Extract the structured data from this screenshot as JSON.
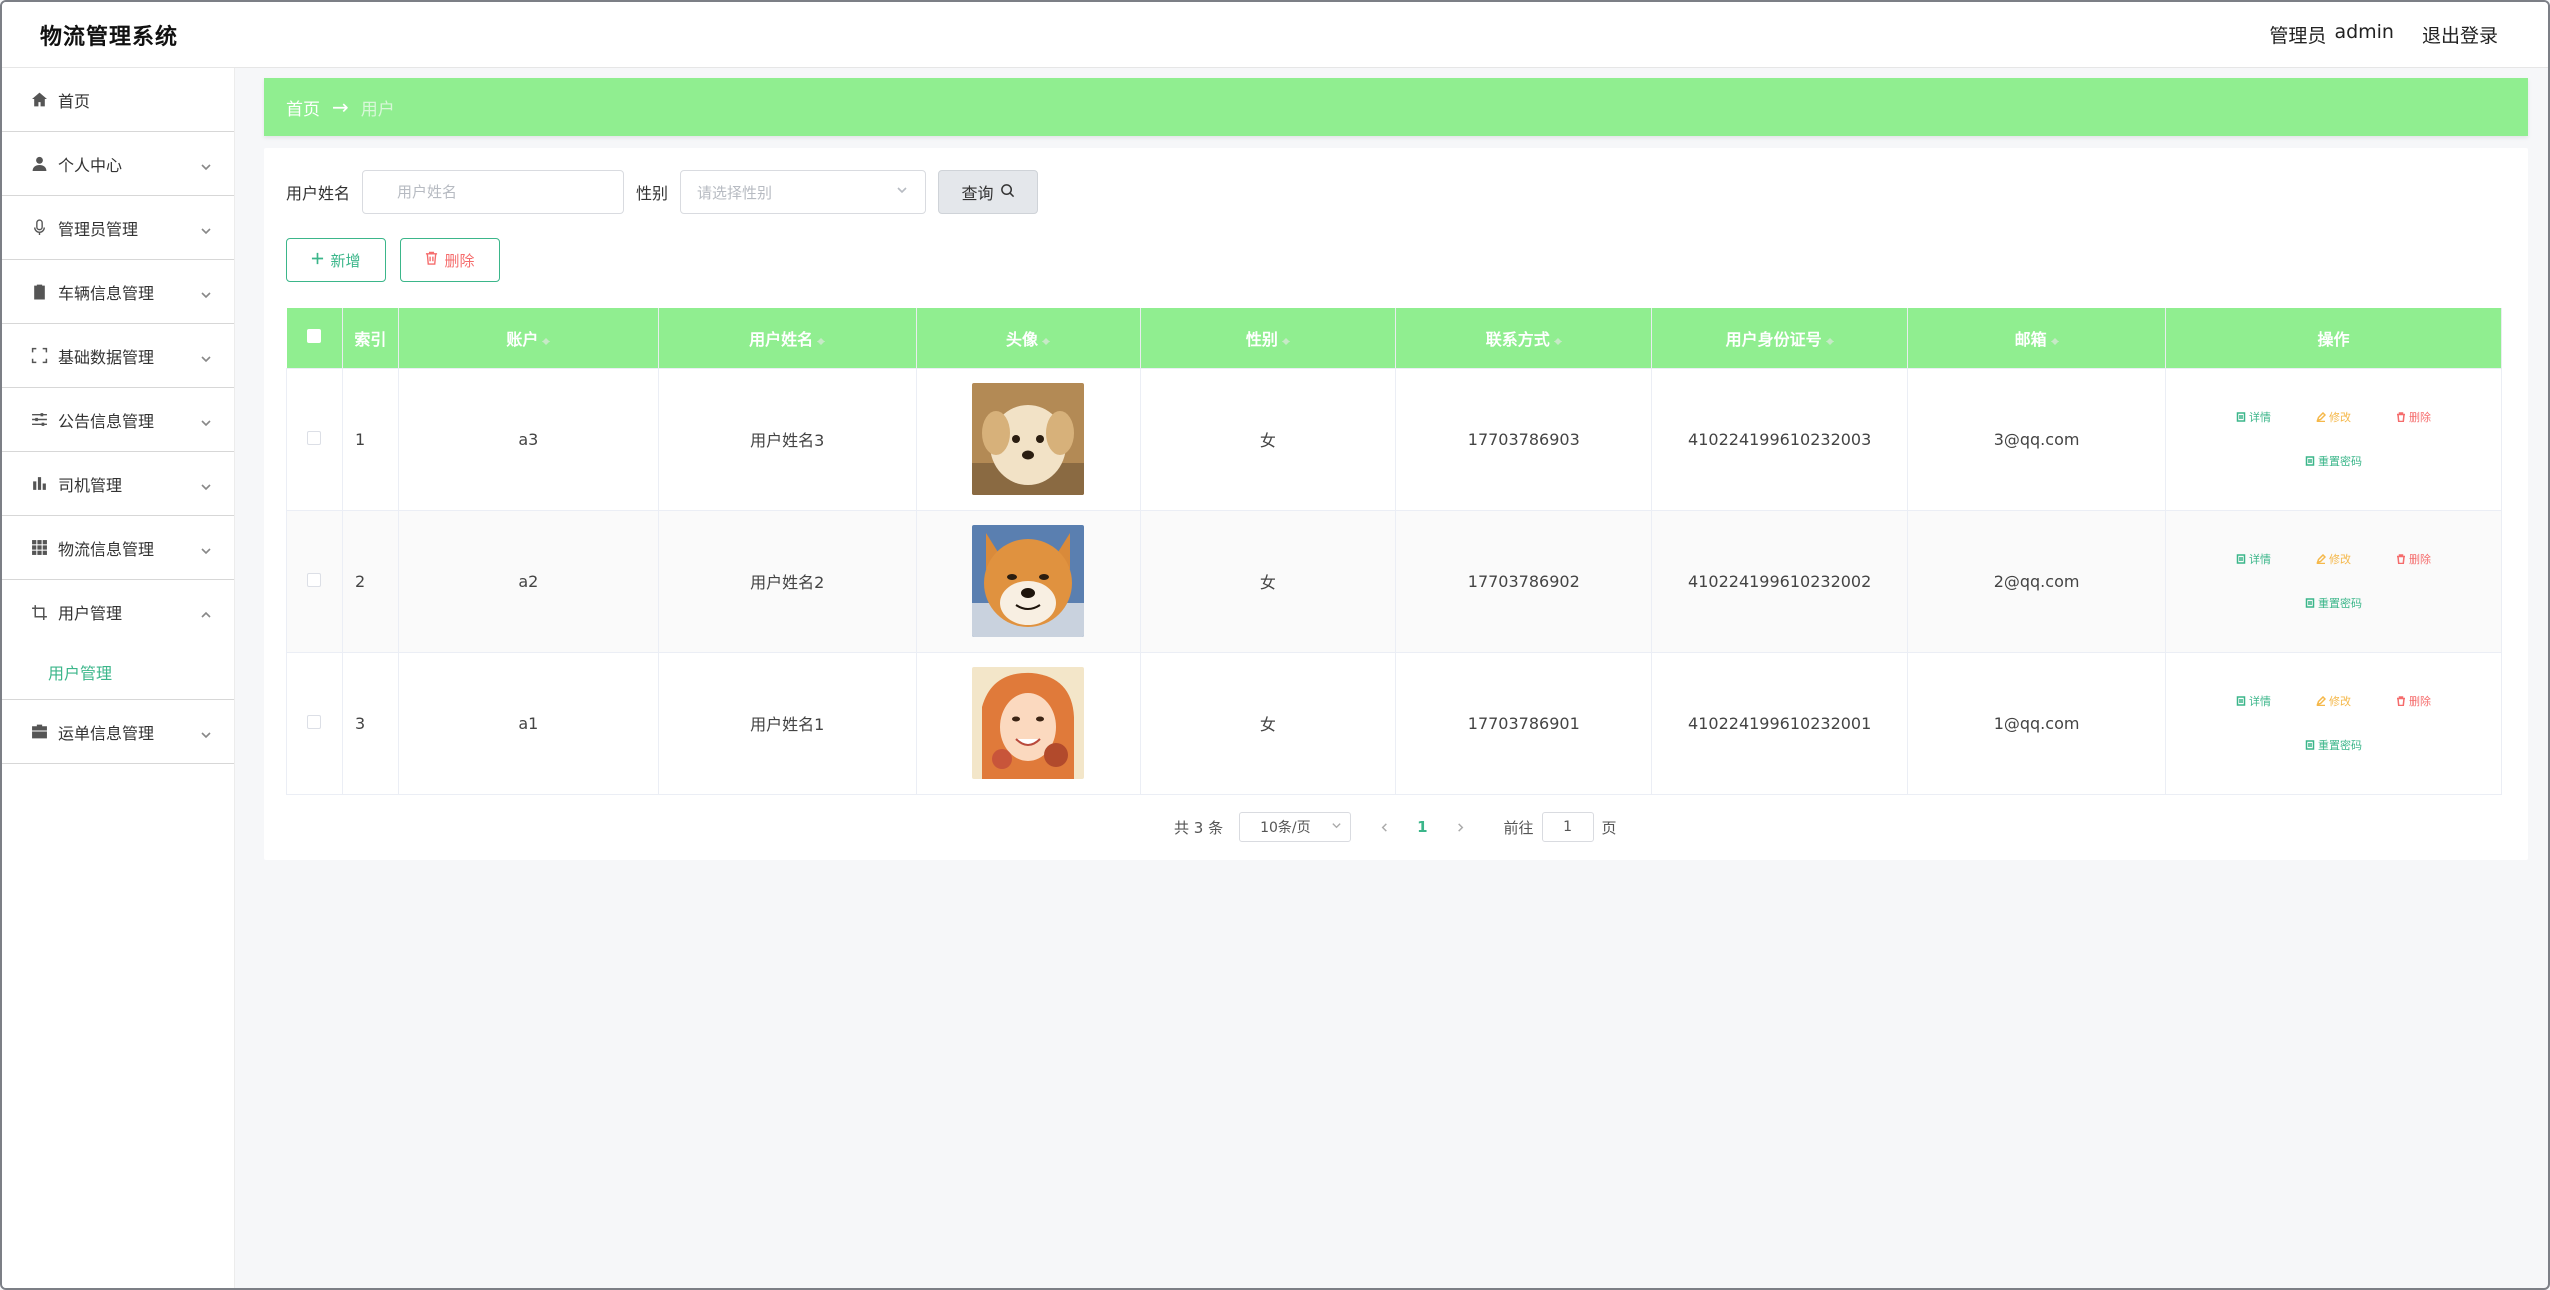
{
  "header": {
    "app_title": "物流管理系统",
    "role": "管理员",
    "username": "admin",
    "logout": "退出登录"
  },
  "sidebar": {
    "items": [
      {
        "label": "首页",
        "icon": "home-icon"
      },
      {
        "label": "个人中心",
        "icon": "user-icon"
      },
      {
        "label": "管理员管理",
        "icon": "microphone-icon"
      },
      {
        "label": "车辆信息管理",
        "icon": "clipboard-icon"
      },
      {
        "label": "基础数据管理",
        "icon": "fullscreen-icon"
      },
      {
        "label": "公告信息管理",
        "icon": "sliders-icon"
      },
      {
        "label": "司机管理",
        "icon": "bar-chart-icon"
      },
      {
        "label": "物流信息管理",
        "icon": "grid-icon"
      },
      {
        "label": "用户管理",
        "icon": "crop-icon"
      },
      {
        "label": "运单信息管理",
        "icon": "briefcase-icon"
      }
    ],
    "submenu_user": "用户管理"
  },
  "breadcrumb": {
    "home": "首页",
    "arrow": "→",
    "current": "用户"
  },
  "search": {
    "name_label": "用户姓名",
    "name_placeholder": "用户姓名",
    "gender_label": "性别",
    "gender_placeholder": "请选择性别",
    "query_button": "查询"
  },
  "actions": {
    "add": "新增",
    "delete": "删除"
  },
  "table": {
    "headers": {
      "index": "索引",
      "account": "账户",
      "name": "用户姓名",
      "avatar": "头像",
      "gender": "性别",
      "phone": "联系方式",
      "id_card": "用户身份证号",
      "email": "邮箱",
      "ops": "操作"
    },
    "rows": [
      {
        "index": "1",
        "account": "a3",
        "name": "用户姓名3",
        "gender": "女",
        "phone": "17703786903",
        "id_card": "410224199610232003",
        "email": "3@qq.com"
      },
      {
        "index": "2",
        "account": "a2",
        "name": "用户姓名2",
        "gender": "女",
        "phone": "17703786902",
        "id_card": "410224199610232002",
        "email": "2@qq.com"
      },
      {
        "index": "3",
        "account": "a1",
        "name": "用户姓名1",
        "gender": "女",
        "phone": "17703786901",
        "id_card": "410224199610232001",
        "email": "1@qq.com"
      }
    ],
    "ops": {
      "detail": "详情",
      "edit": "修改",
      "remove": "删除",
      "reset": "重置密码"
    }
  },
  "pagination": {
    "total": "共 3 条",
    "page_size": "10条/页",
    "current_page": "1",
    "goto_prefix": "前往",
    "goto_value": "1",
    "goto_suffix": "页"
  },
  "colors": {
    "accent_green": "#90ee90",
    "link_green": "#3bb68a",
    "danger": "#f56c6c",
    "warning": "#f5b84a"
  }
}
